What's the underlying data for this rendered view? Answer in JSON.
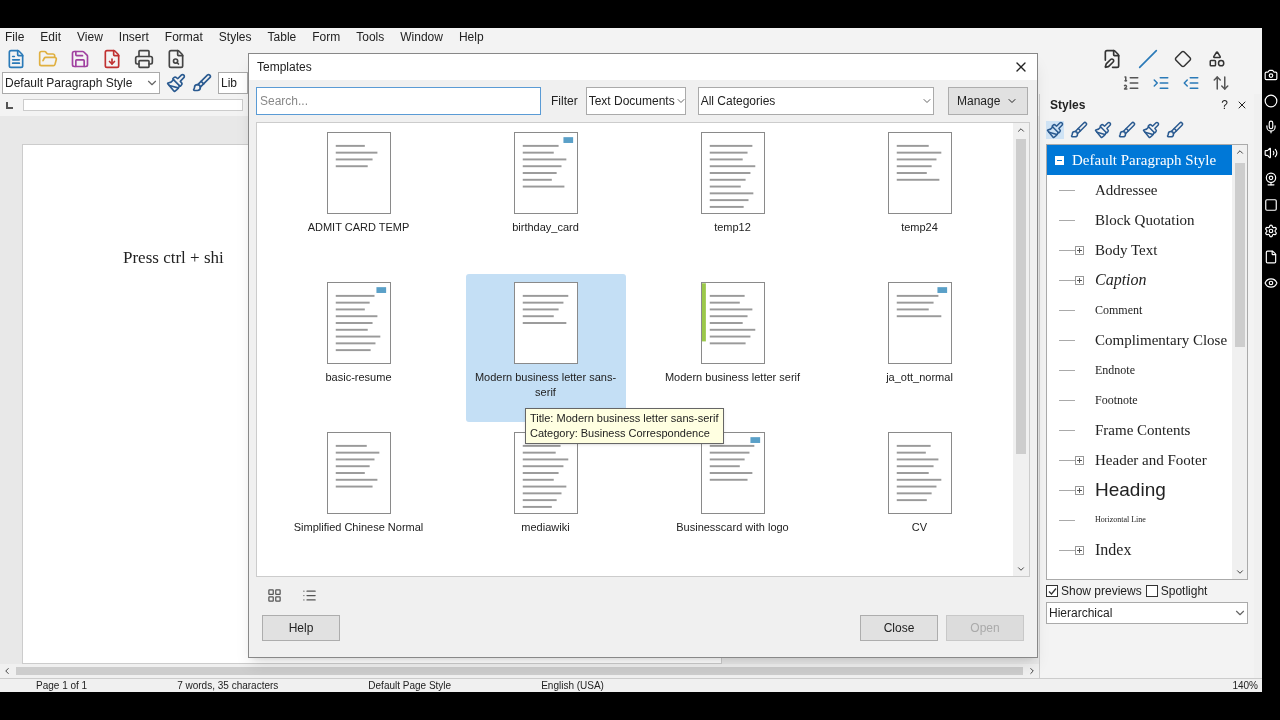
{
  "menu": [
    "File",
    "Edit",
    "View",
    "Insert",
    "Format",
    "Styles",
    "Table",
    "Form",
    "Tools",
    "Window",
    "Help"
  ],
  "paragraph_style": "Default Paragraph Style",
  "font_name": "Lib",
  "document": {
    "text": "Press ctrl + shi"
  },
  "styles_panel": {
    "title": "Styles",
    "help": "?",
    "tree": {
      "label": "Default Paragraph Style",
      "selected": true,
      "expanded": true,
      "children": [
        {
          "label": "Addressee",
          "kind": "leaf",
          "selected": false
        },
        {
          "label": "Block Quotation",
          "kind": "leaf",
          "selected": false
        },
        {
          "label": "Body Text",
          "kind": "group",
          "expanded": false,
          "selected": false
        },
        {
          "label": "Caption",
          "kind": "group",
          "expanded": false,
          "selected": false
        },
        {
          "label": "Comment",
          "kind": "leaf",
          "selected": false
        },
        {
          "label": "Complimentary Close",
          "kind": "leaf",
          "selected": false
        },
        {
          "label": "Endnote",
          "kind": "leaf",
          "selected": false
        },
        {
          "label": "Footnote",
          "kind": "leaf",
          "selected": false
        },
        {
          "label": "Frame Contents",
          "kind": "leaf",
          "selected": false
        },
        {
          "label": "Header and Footer",
          "kind": "group",
          "expanded": false,
          "selected": false
        },
        {
          "label": "Heading",
          "kind": "group",
          "expanded": false,
          "selected": false
        },
        {
          "label": "Horizontal Line",
          "kind": "leaf",
          "selected": false
        },
        {
          "label": "Index",
          "kind": "group",
          "expanded": false,
          "selected": false
        }
      ]
    },
    "show_previews": {
      "label": "Show previews",
      "checked": true
    },
    "spotlight": {
      "label": "Spotlight",
      "checked": false
    },
    "view_mode": "Hierarchical"
  },
  "dialog": {
    "title": "Templates",
    "search": {
      "placeholder": "Search..."
    },
    "filter_label": "Filter",
    "filter": "Text Documents",
    "category": "All Categories",
    "manage": "Manage",
    "templates": [
      {
        "name": "ADMIT CARD TEMP",
        "selected": false
      },
      {
        "name": "birthday_card",
        "selected": false
      },
      {
        "name": "temp12",
        "selected": false
      },
      {
        "name": "temp24",
        "selected": false
      },
      {
        "name": "basic-resume",
        "selected": false
      },
      {
        "name": "Modern business letter sans-serif",
        "selected": true
      },
      {
        "name": "Modern business letter serif",
        "selected": false
      },
      {
        "name": "ja_ott_normal",
        "selected": false
      },
      {
        "name": "Simplified Chinese Normal",
        "selected": false
      },
      {
        "name": "mediawiki",
        "selected": false
      },
      {
        "name": "Businesscard with logo",
        "selected": false
      },
      {
        "name": "CV",
        "selected": false
      }
    ],
    "tooltip": [
      "Title: Modern business letter sans-serif",
      "Category: Business Correspondence"
    ],
    "buttons": [
      {
        "label": "Help",
        "disabled": false
      },
      {
        "label": "Close",
        "disabled": false
      },
      {
        "label": "Open",
        "disabled": true
      }
    ]
  },
  "status_bar": [
    "Page 1 of 1",
    "7 words, 35 characters",
    "Default Page Style",
    "English (USA)",
    "140%"
  ]
}
